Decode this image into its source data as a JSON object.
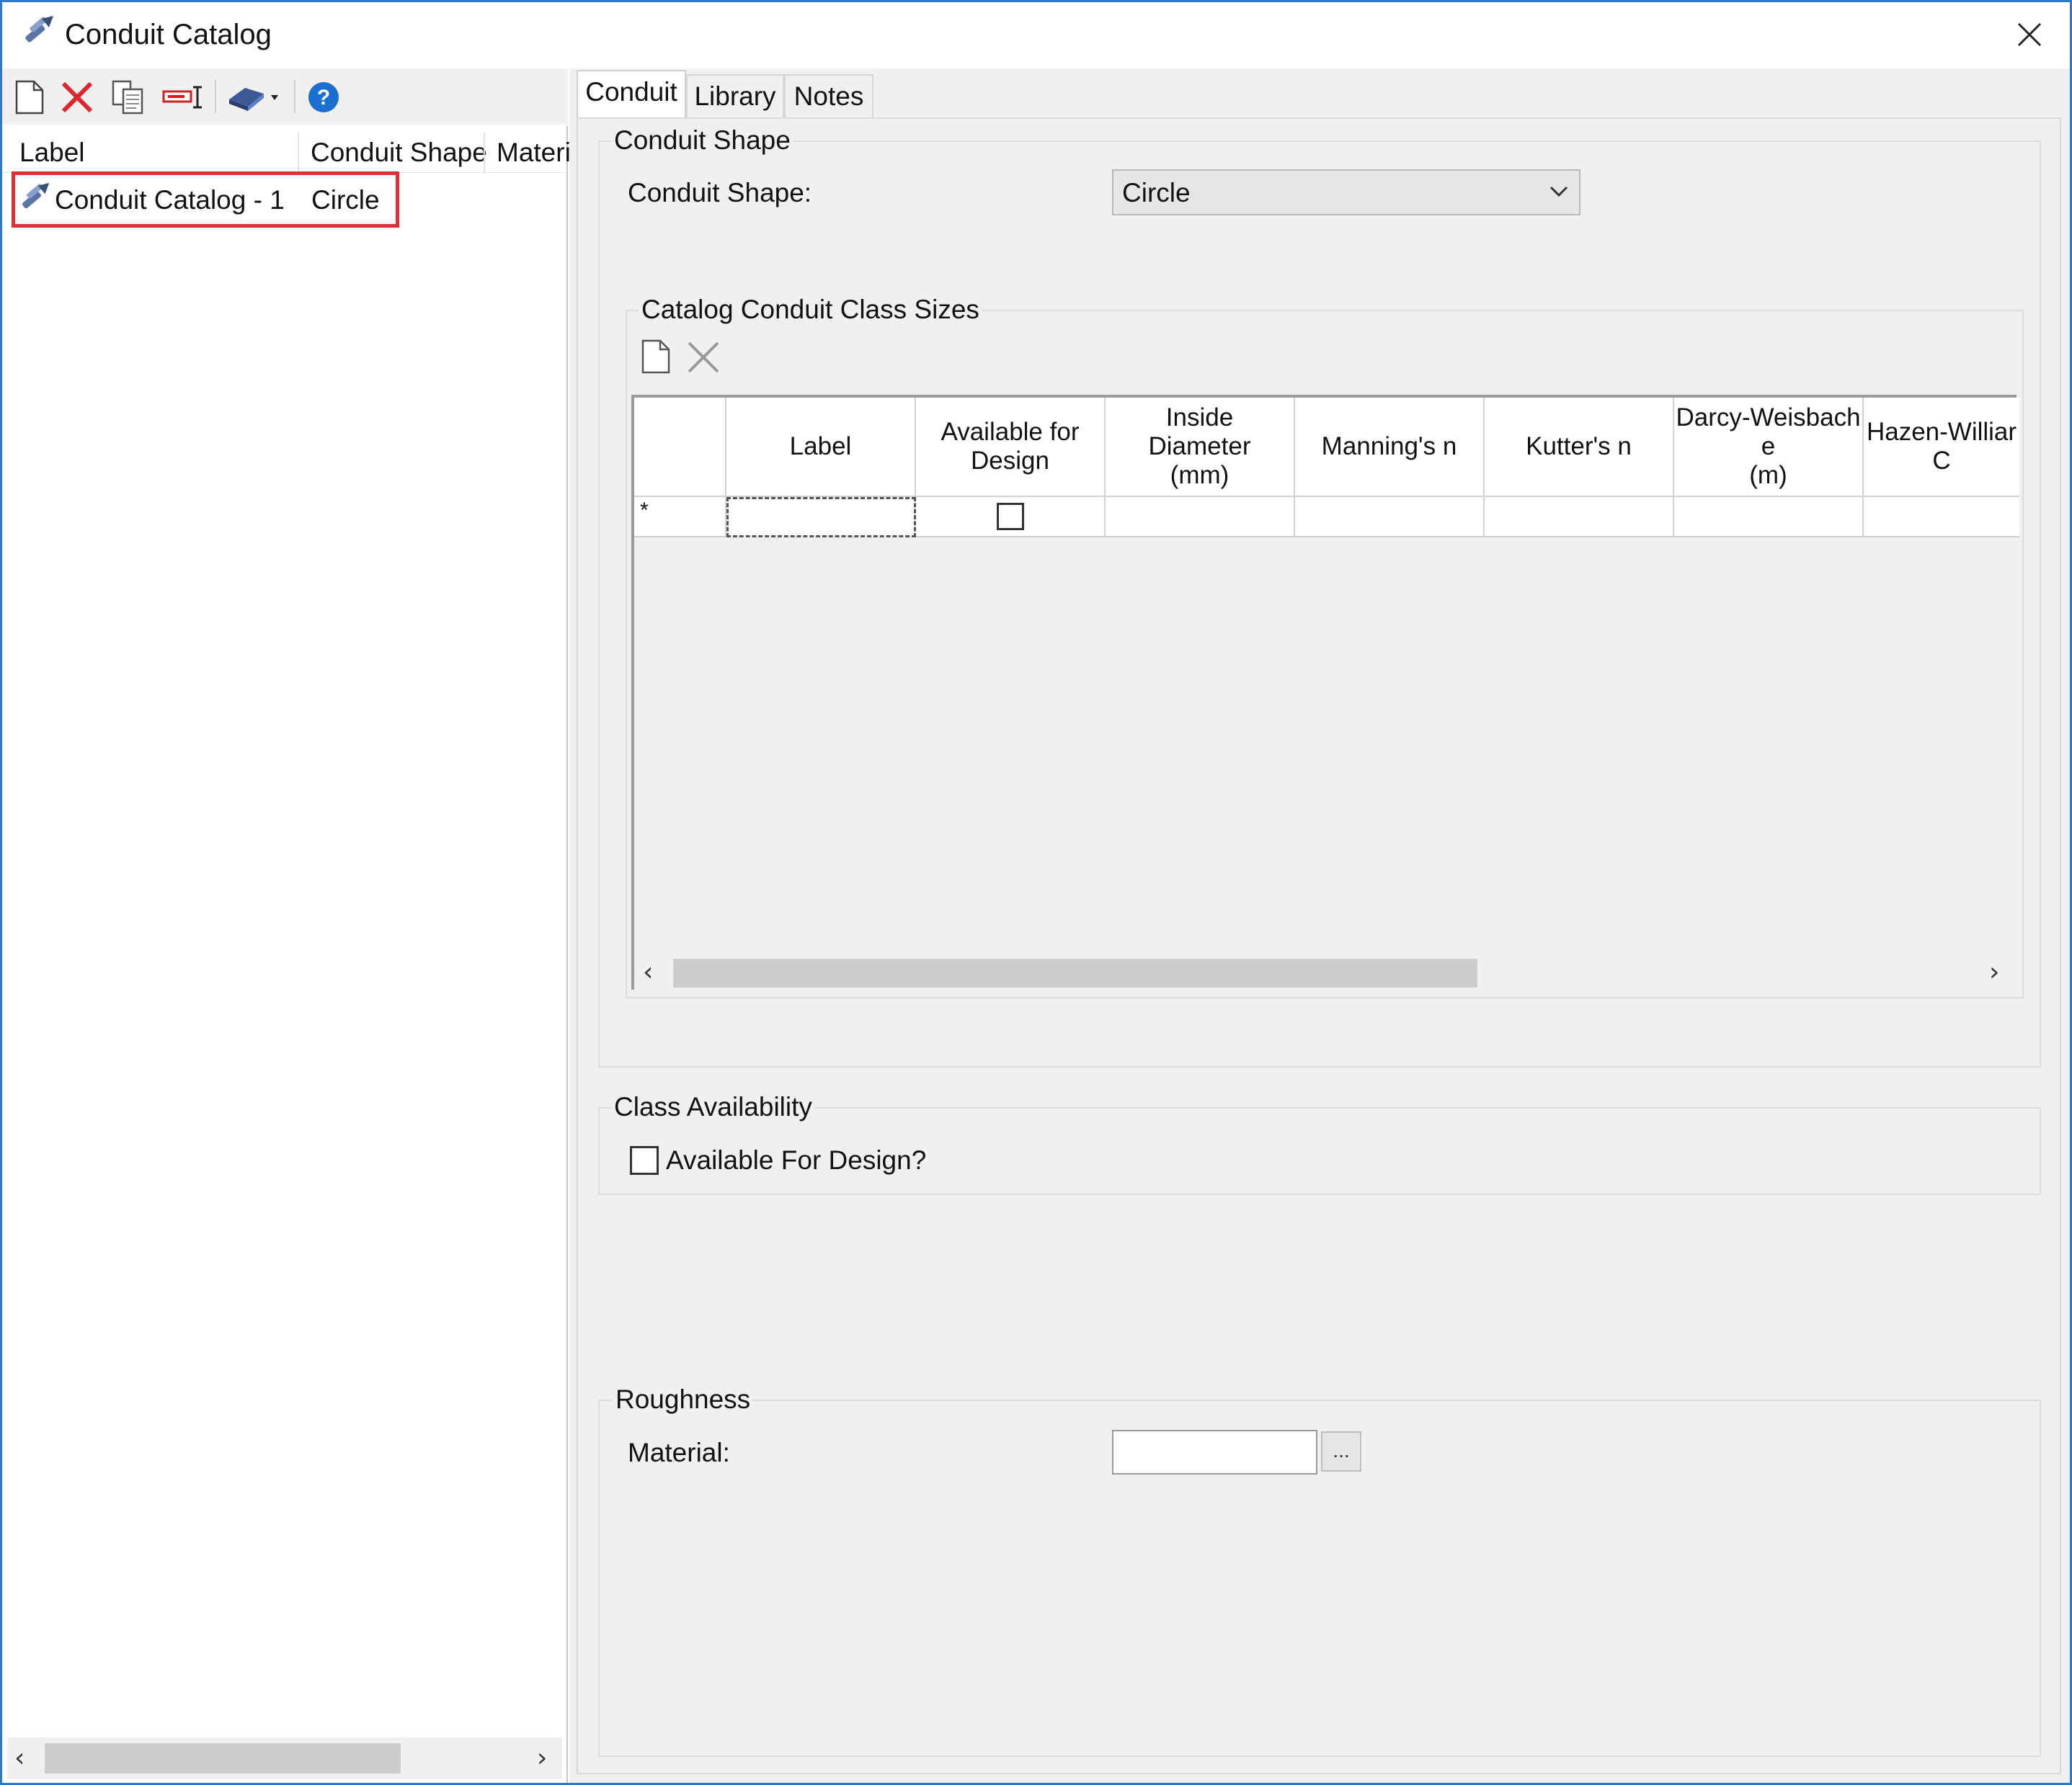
{
  "window": {
    "title": "Conduit Catalog"
  },
  "left": {
    "columns": [
      "Label",
      "Conduit Shape",
      "Materi"
    ],
    "rows": [
      {
        "label": "Conduit Catalog - 1",
        "shape": "Circle"
      }
    ]
  },
  "tabs": [
    "Conduit",
    "Library",
    "Notes"
  ],
  "conduit_shape": {
    "group_title": "Conduit Shape",
    "label": "Conduit Shape:",
    "value": "Circle"
  },
  "class_sizes": {
    "group_title": "Catalog Conduit Class Sizes",
    "columns": [
      "",
      "Label",
      "Available for\nDesign",
      "Inside\nDiameter\n(mm)",
      "Manning's n",
      "Kutter's n",
      "Darcy-Weisbach\ne\n(m)",
      "Hazen-Williar\nC"
    ],
    "new_row_marker": "*"
  },
  "class_availability": {
    "group_title": "Class Availability",
    "checkbox_label": "Available For Design?"
  },
  "roughness": {
    "group_title": "Roughness",
    "material_label": "Material:",
    "material_value": "",
    "browse_label": "..."
  },
  "colors": {
    "selection_outline": "#e0303a",
    "window_border": "#2b79c8",
    "help_blue": "#1a6fd1"
  }
}
